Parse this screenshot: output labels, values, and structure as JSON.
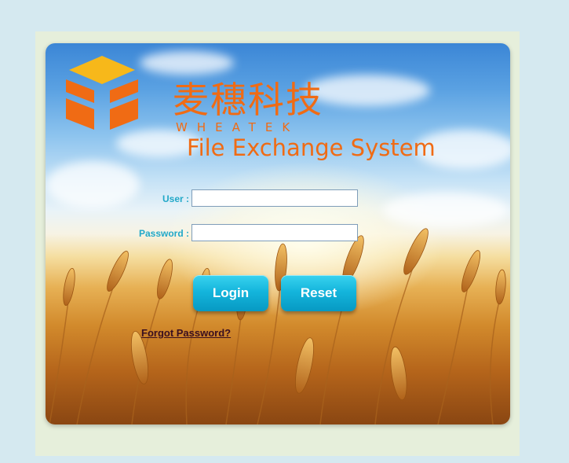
{
  "brand": {
    "name_cn": "麦穗科技",
    "name_en": "WHEATEK"
  },
  "system_title": "File Exchange System",
  "form": {
    "user_label": "User :",
    "user_value": "",
    "password_label": "Password :",
    "password_value": ""
  },
  "buttons": {
    "login": "Login",
    "reset": "Reset"
  },
  "links": {
    "forgot_password": "Forgot Password?"
  },
  "colors": {
    "brand_orange": "#f06b14",
    "label_cyan": "#21a8c8",
    "button_cyan": "#14b5dc",
    "page_background": "#d5e9f0"
  }
}
